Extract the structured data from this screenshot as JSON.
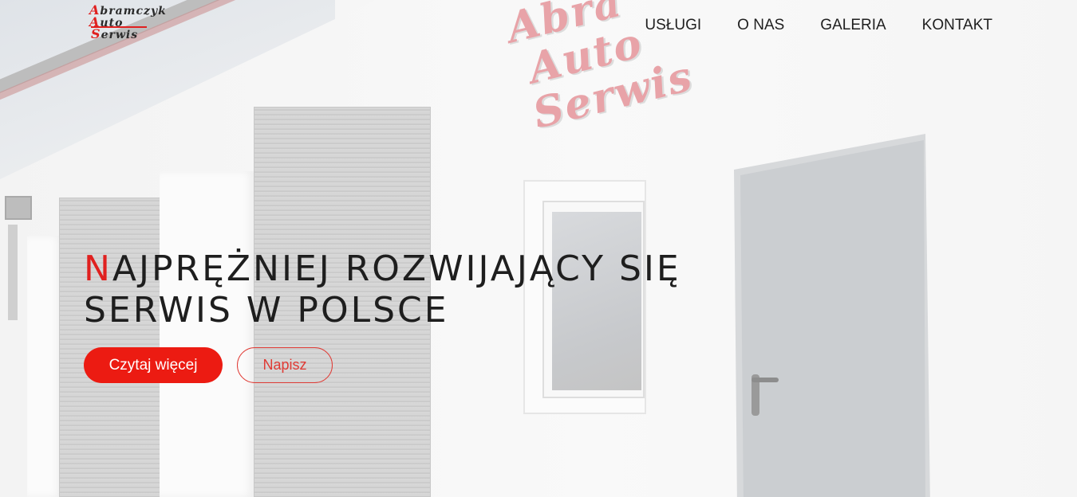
{
  "logo": {
    "line1": "Abramczyk",
    "line2": "Auto",
    "line3": "Serwis",
    "cap1": "A",
    "cap2": "A",
    "cap3": "S",
    "rest1": "bramczyk",
    "rest2": "uto",
    "rest3": "erwis"
  },
  "nav": {
    "items": [
      {
        "label": "USŁUGI"
      },
      {
        "label": "O NAS"
      },
      {
        "label": "GALERIA"
      },
      {
        "label": "KONTAKT"
      }
    ]
  },
  "hero": {
    "title_first_letter": "N",
    "title_rest_line1": "AJPRĘŻNIEJ ROZWIJAJĄCY SIĘ",
    "title_line2": "SERWIS W POLSCE",
    "primary_button": "Czytaj więcej",
    "secondary_button": "Napisz"
  },
  "background_sign": {
    "line1": "Abra",
    "line2": "Auto",
    "line3": "Serwis"
  },
  "colors": {
    "accent": "#ec1b12",
    "text": "#1e1e1e"
  }
}
